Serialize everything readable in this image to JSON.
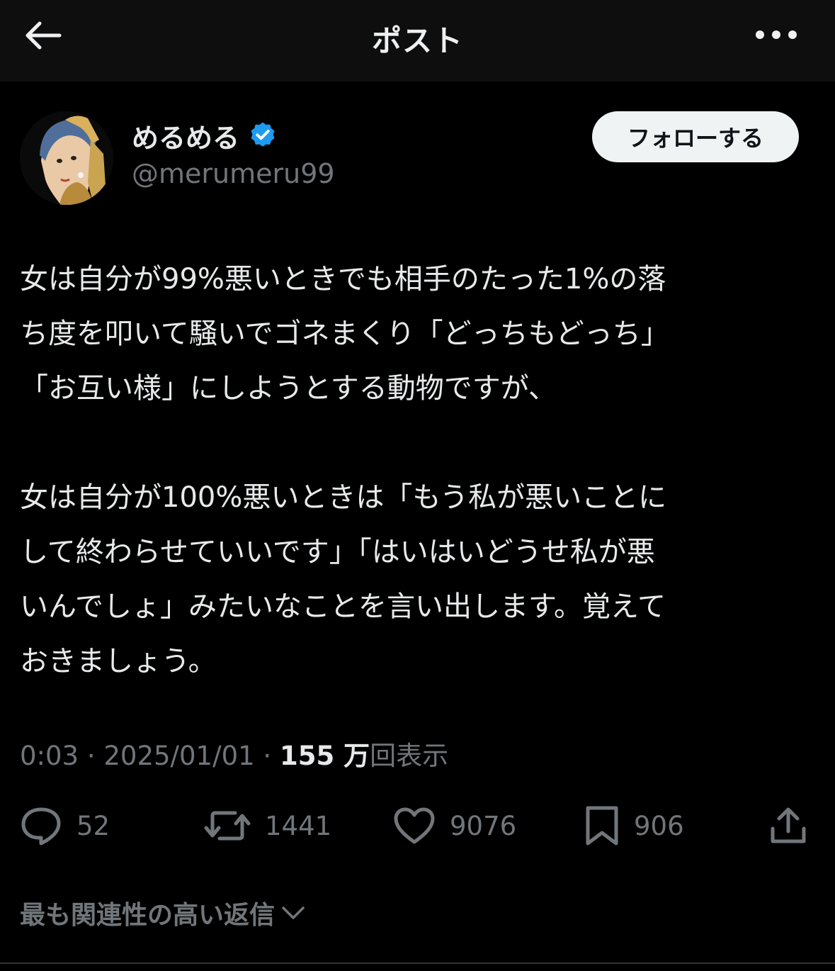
{
  "header": {
    "title": "ポスト",
    "back_icon": "arrow-left-icon",
    "more_icon": "more-horizontal-icon"
  },
  "author": {
    "display_name": "めるめる",
    "handle": "@merumeru99",
    "verified_icon": "verified-badge-icon",
    "verified_color": "#1d9bf0",
    "follow_label": "フォローする"
  },
  "post": {
    "paragraphs": [
      "女は自分が99%悪いときでも相手のたった1%の落\nち度を叩いて騒いでゴネまくり「どっちもどっち」\n「お互い様」にしようとする動物ですが、",
      "女は自分が100%悪いときは「もう私が悪いことに\nして終わらせていいです」「はいはいどうせ私が悪\nいんでしょ」みたいなことを言い出します。覚えて\nおきましょう。"
    ],
    "time": "0:03",
    "separator": "·",
    "date": "2025/01/01",
    "views_count": "155 万",
    "views_label": "回表示"
  },
  "actions": {
    "replies": "52",
    "reposts": "1441",
    "likes": "9076",
    "bookmarks": "906"
  },
  "replies_sort": {
    "label": "最も関連性の高い返信"
  },
  "colors": {
    "background": "#000000",
    "header_bg": "#0e0e0e",
    "text_primary": "#e7e9ea",
    "text_secondary": "#71767b",
    "accent": "#1d9bf0"
  }
}
